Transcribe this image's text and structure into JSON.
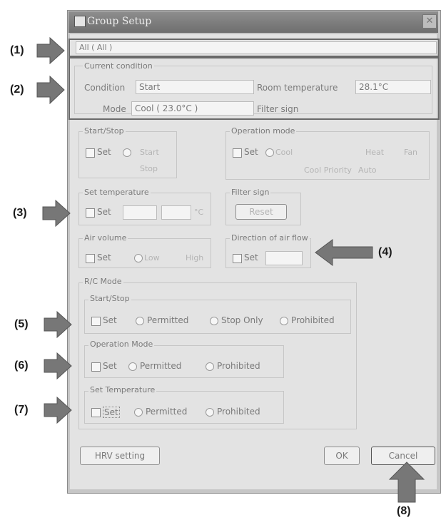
{
  "window": {
    "title": "Group Setup"
  },
  "group_selector": {
    "value": "All ( All )"
  },
  "current_condition": {
    "legend": "Current condition",
    "condition_label": "Condition",
    "condition_value": "Start",
    "room_temp_label": "Room temperature",
    "room_temp_value": "28.1°C",
    "mode_label": "Mode",
    "mode_value": "Cool ( 23.0°C )",
    "filter_sign_label": "Filter sign"
  },
  "start_stop": {
    "legend": "Start/Stop",
    "set_label": "Set",
    "start_label": "Start",
    "stop_label": "Stop"
  },
  "operation_mode": {
    "legend": "Operation mode",
    "set_label": "Set",
    "cool_label": "Cool",
    "heat_label": "Heat",
    "fan_label": "Fan",
    "cool_priority_label": "Cool Priority",
    "auto_label": "Auto"
  },
  "set_temperature": {
    "legend": "Set temperature",
    "set_label": "Set",
    "unit": "°C"
  },
  "filter_sign": {
    "legend": "Filter sign",
    "reset_label": "Reset"
  },
  "air_volume": {
    "legend": "Air volume",
    "set_label": "Set",
    "low_label": "Low",
    "high_label": "High"
  },
  "air_flow": {
    "legend": "Direction of air flow",
    "set_label": "Set"
  },
  "rc_mode": {
    "legend": "R/C Mode",
    "start_stop": {
      "legend": "Start/Stop",
      "set_label": "Set",
      "permitted": "Permitted",
      "stop_only": "Stop Only",
      "prohibited": "Prohibited"
    },
    "operation_mode": {
      "legend": "Operation Mode",
      "set_label": "Set",
      "permitted": "Permitted",
      "prohibited": "Prohibited"
    },
    "set_temperature": {
      "legend": "Set Temperature",
      "set_label": "Set",
      "permitted": "Permitted",
      "prohibited": "Prohibited"
    }
  },
  "buttons": {
    "hrv": "HRV setting",
    "ok": "OK",
    "cancel": "Cancel"
  },
  "callouts": {
    "c1": "(1)",
    "c2": "(2)",
    "c3": "(3)",
    "c4": "(4)",
    "c5": "(5)",
    "c6": "(6)",
    "c7": "(7)",
    "c8": "(8)"
  },
  "colors": {
    "arrow": "#777777",
    "highlight_box": "#6a6a6a",
    "title_bar": "#7e7e7e"
  }
}
